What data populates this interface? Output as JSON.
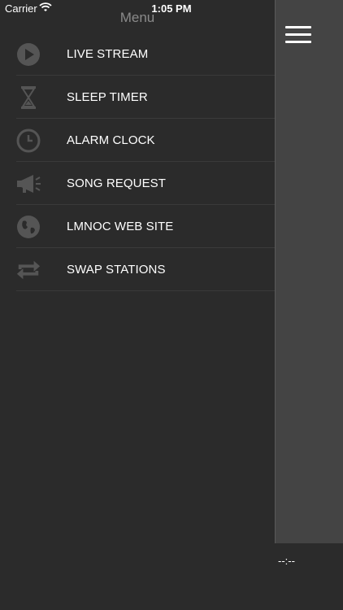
{
  "status_bar": {
    "carrier": "Carrier",
    "time": "1:05 PM"
  },
  "menu": {
    "title": "Menu",
    "items": [
      {
        "label": "LIVE STREAM",
        "icon": "play-icon"
      },
      {
        "label": "SLEEP TIMER",
        "icon": "hourglass-icon"
      },
      {
        "label": "ALARM CLOCK",
        "icon": "clock-icon"
      },
      {
        "label": "SONG REQUEST",
        "icon": "megaphone-icon"
      },
      {
        "label": "LMNOC WEB SITE",
        "icon": "globe-icon"
      },
      {
        "label": "SWAP STATIONS",
        "icon": "swap-icon"
      }
    ]
  },
  "player": {
    "time": "--:--"
  },
  "colors": {
    "background": "#2b2b2b",
    "panel": "#444444",
    "icon": "#555555"
  }
}
